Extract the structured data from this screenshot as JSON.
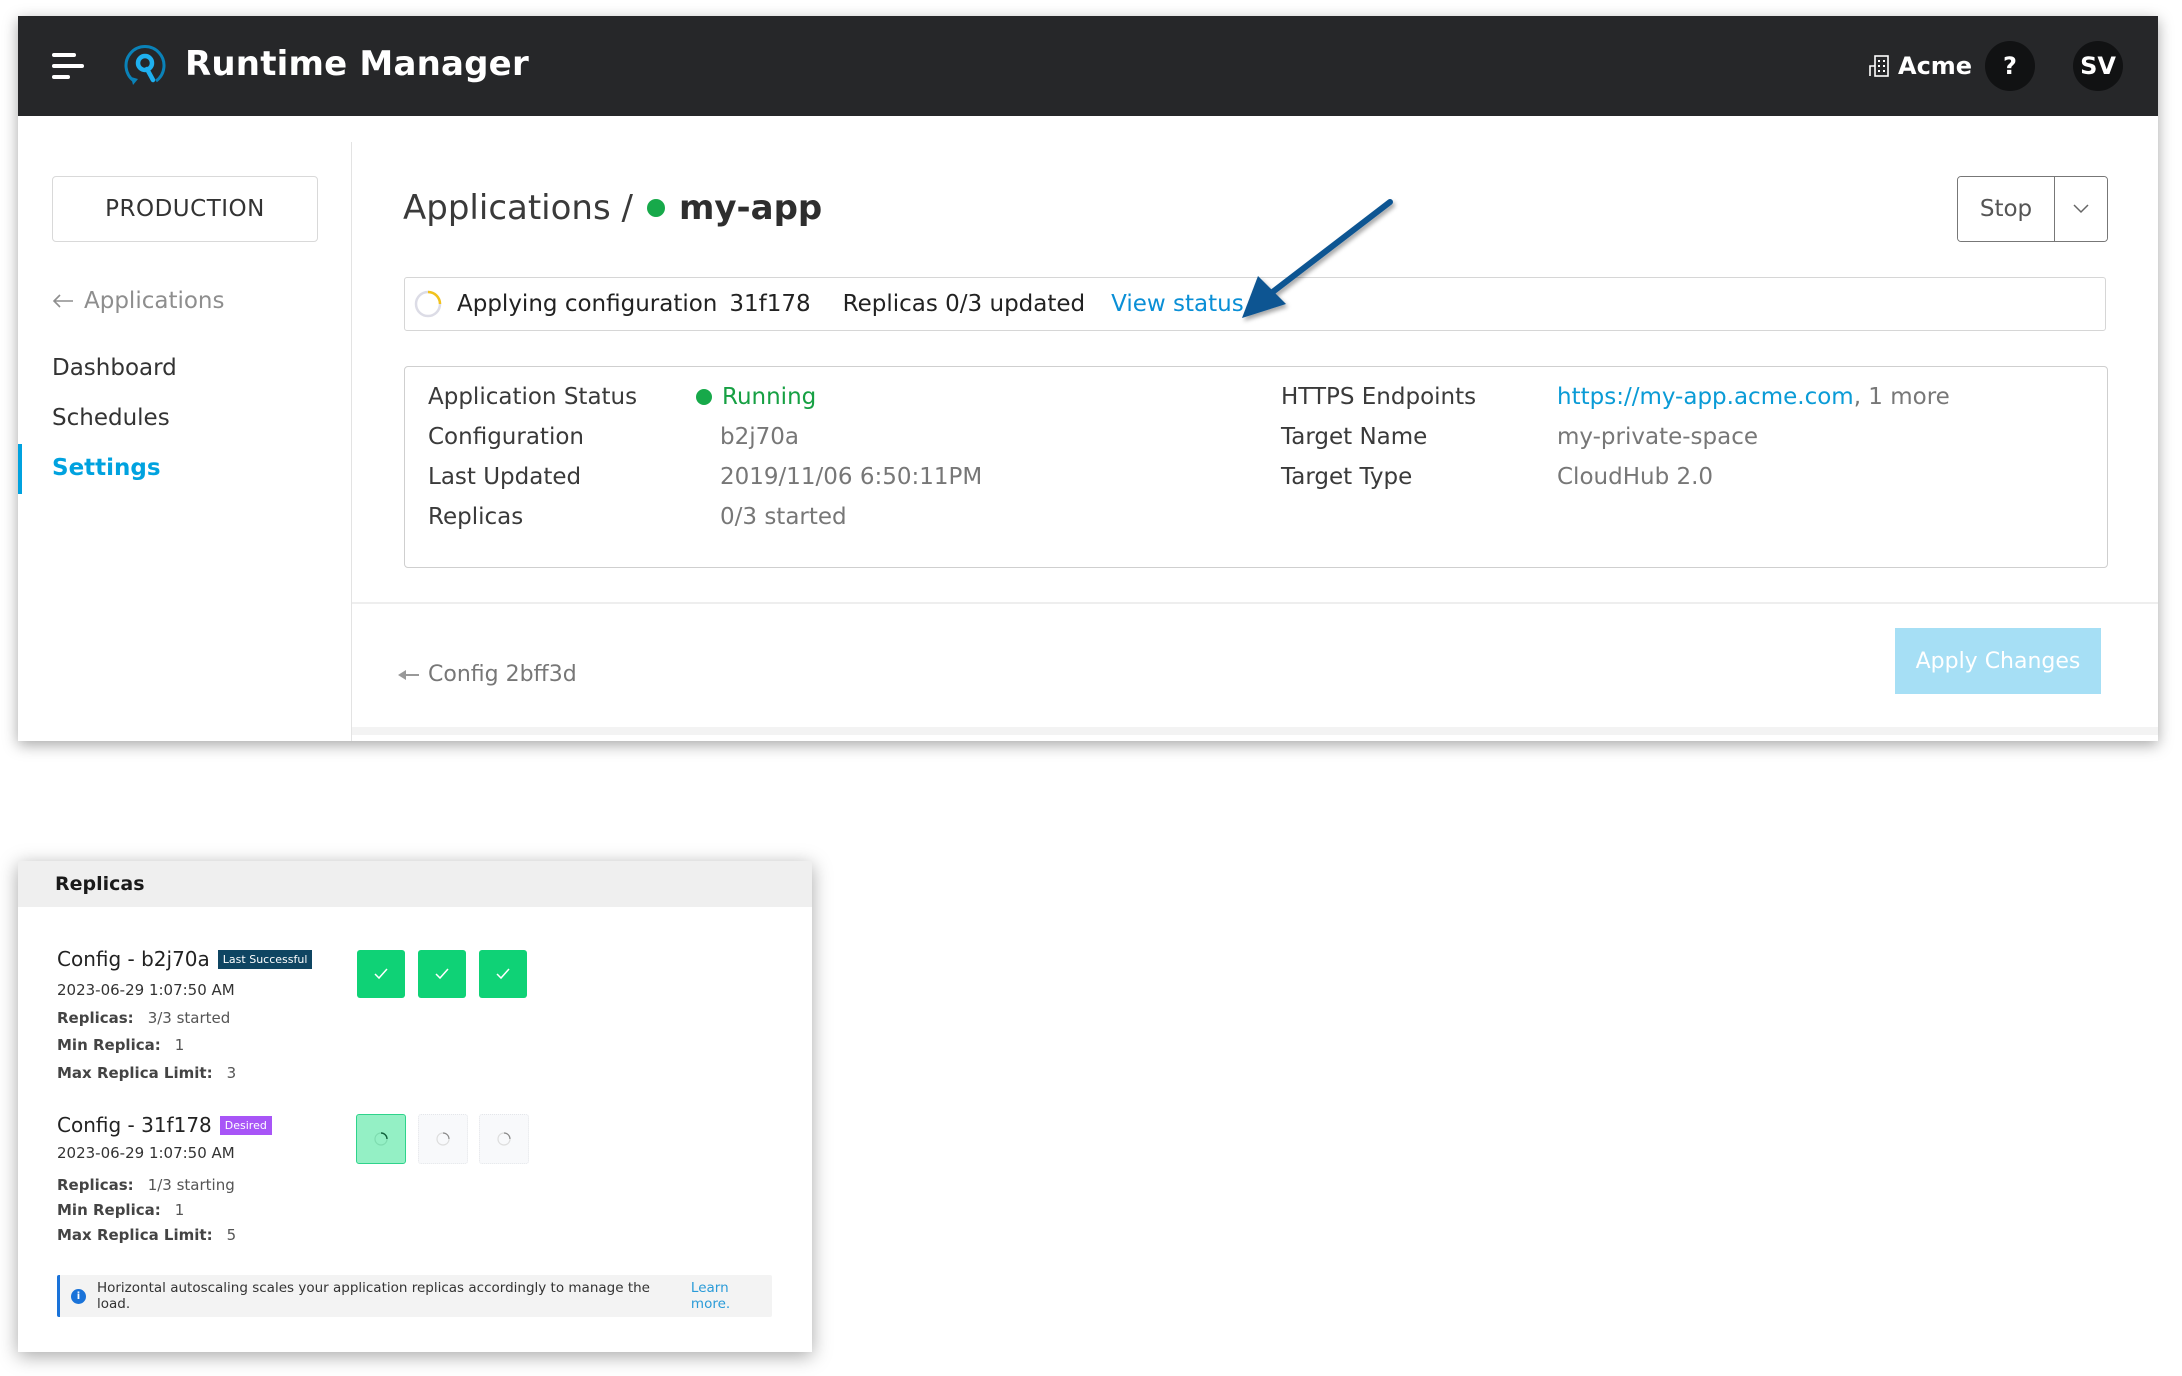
{
  "header": {
    "app_title": "Runtime Manager",
    "org_name": "Acme",
    "help_label": "?",
    "avatar_initials": "SV",
    "colors": {
      "bar": "#262729",
      "logo": "#00a2df"
    }
  },
  "sidebar": {
    "environment": "PRODUCTION",
    "back_label": "Applications",
    "items": [
      {
        "label": "Dashboard",
        "active": false
      },
      {
        "label": "Schedules",
        "active": false
      },
      {
        "label": "Settings",
        "active": true
      }
    ]
  },
  "page": {
    "breadcrumb_root": "Applications /",
    "app_name": "my-app",
    "app_status_color": "#17a94a",
    "stop_label": "Stop"
  },
  "banner": {
    "applying_label": "Applying configuration",
    "config_id": "31f178",
    "replicas_text": "Replicas 0/3 updated",
    "view_status": "View status"
  },
  "details": {
    "left": [
      {
        "label": "Application Status",
        "value": "Running"
      },
      {
        "label": "Configuration",
        "value": "b2j70a"
      },
      {
        "label": "Last Updated",
        "value": "2019/11/06 6:50:11PM"
      },
      {
        "label": "Replicas",
        "value": "0/3 started"
      }
    ],
    "right": [
      {
        "label": "HTTPS Endpoints",
        "value": "https://my-app.acme.com",
        "extra": ", 1 more"
      },
      {
        "label": "Target Name",
        "value": "my-private-space"
      },
      {
        "label": "Target Type",
        "value": "CloudHub 2.0"
      }
    ]
  },
  "footer": {
    "config_back": "Config 2bff3d",
    "apply_label": "Apply Changes"
  },
  "replicas_panel": {
    "title": "Replicas",
    "configs": [
      {
        "name": "Config - b2j70a",
        "badge": "Last Successful",
        "timestamp": "2023-06-29 1:07:50 AM",
        "replicas_label": "Replicas:",
        "replicas_value": "3/3 started",
        "min_label": "Min Replica:",
        "min_value": "1",
        "max_label": "Max Replica Limit:",
        "max_value": "3",
        "replica_states": [
          "started",
          "started",
          "started"
        ]
      },
      {
        "name": "Config - 31f178",
        "badge": "Desired",
        "timestamp": "2023-06-29 1:07:50 AM",
        "replicas_label": "Replicas:",
        "replicas_value": "1/3 starting",
        "min_label": "Min Replica:",
        "min_value": "1",
        "max_label": "Max Replica Limit:",
        "max_value": "5",
        "replica_states": [
          "starting",
          "pending",
          "pending"
        ]
      }
    ],
    "note": "Horizontal autoscaling scales your application replicas accordingly to manage the load.",
    "learn_more": "Learn more."
  }
}
